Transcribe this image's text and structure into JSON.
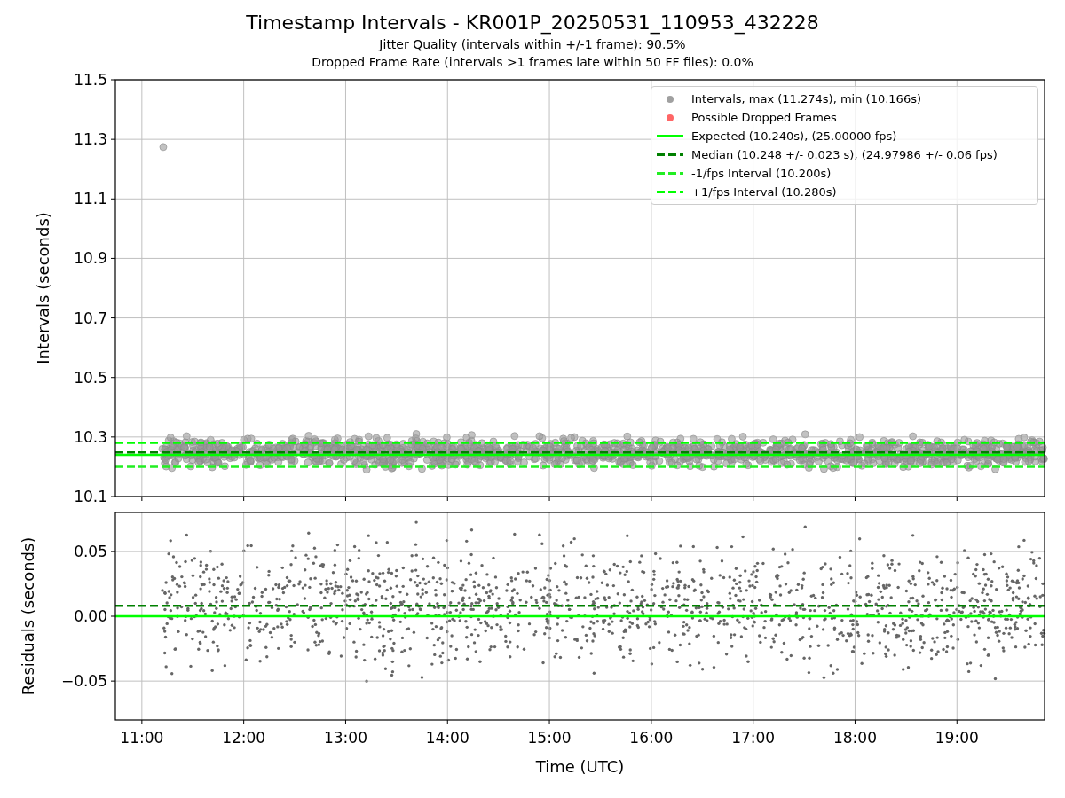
{
  "title": "Timestamp Intervals - KR001P_20250531_110953_432228",
  "subtitles": [
    "Jitter Quality (intervals within +/-1 frame): 90.5%",
    "Dropped Frame Rate (intervals >1 frames late within 50 FF files): 0.0%"
  ],
  "intervals_plot": {
    "chart_data": {
      "type": "line",
      "ylabel": "Intervals (seconds)",
      "grid": true,
      "x": [
        10.74,
        19.86
      ],
      "xlim": [
        10.74,
        19.86
      ],
      "ylim": [
        10.1,
        11.5
      ],
      "yticks": [
        {
          "value": 10.1,
          "label": "10.1"
        },
        {
          "value": 10.3,
          "label": "10.3"
        },
        {
          "value": 10.5,
          "label": "10.5"
        },
        {
          "value": 10.7,
          "label": "10.7"
        },
        {
          "value": 10.9,
          "label": "10.9"
        },
        {
          "value": 11.1,
          "label": "11.1"
        },
        {
          "value": 11.3,
          "label": "11.3"
        },
        {
          "value": 11.5,
          "label": "11.5"
        }
      ],
      "series": [
        {
          "color": "#22ee22",
          "line_style": "dashed",
          "values": [
            10.2,
            10.2
          ]
        },
        {
          "color": "#00ff00",
          "line_style": "dashed",
          "values": [
            10.28,
            10.28
          ]
        },
        {
          "color": "#00ff00",
          "line_style": "solid",
          "values": [
            10.24,
            10.24
          ]
        },
        {
          "color": "#008000",
          "line_style": "dashed",
          "values": [
            10.248,
            10.248
          ]
        }
      ]
    },
    "legend": [
      {
        "kind": "marker",
        "color": "#a0a0a0",
        "label": "Intervals, max (11.274s), min (10.166s)"
      },
      {
        "kind": "marker",
        "color": "#ff6666",
        "label": "Possible Dropped Frames"
      },
      {
        "kind": "line",
        "color": "#00ff00",
        "label": "Expected (10.240s), (25.00000 fps)"
      },
      {
        "kind": "dashed",
        "color": "#008000",
        "label": "Median (10.248 +/- 0.023 s), (24.97986 +/- 0.06 fps)"
      },
      {
        "kind": "dashed",
        "color": "#22ee22",
        "label": "-1/fps Interval (10.200s)"
      },
      {
        "kind": "dashed",
        "color": "#00ff00",
        "label": "+1/fps Interval (10.280s)"
      }
    ]
  },
  "residuals_plot": {
    "chart_data": {
      "type": "line",
      "xlabel": "Time (UTC)",
      "ylabel": "Residuals (seconds)",
      "grid": true,
      "x": [
        10.74,
        19.86
      ],
      "xlim": [
        10.74,
        19.86
      ],
      "ylim": [
        -0.08,
        0.08
      ],
      "xticks": [
        {
          "value": 11,
          "label": "11:00"
        },
        {
          "value": 12,
          "label": "12:00"
        },
        {
          "value": 13,
          "label": "13:00"
        },
        {
          "value": 14,
          "label": "14:00"
        },
        {
          "value": 15,
          "label": "15:00"
        },
        {
          "value": 16,
          "label": "16:00"
        },
        {
          "value": 17,
          "label": "17:00"
        },
        {
          "value": 18,
          "label": "18:00"
        },
        {
          "value": 19,
          "label": "19:00"
        }
      ],
      "yticks": [
        {
          "value": -0.05,
          "label": "−0.05"
        },
        {
          "value": 0,
          "label": "0.00"
        },
        {
          "value": 0.05,
          "label": "0.05"
        }
      ],
      "series": [
        {
          "color": "#00ff00",
          "line_style": "solid",
          "values": [
            0,
            0
          ]
        },
        {
          "color": "#008000",
          "line_style": "dashed",
          "values": [
            0.008,
            0.008
          ]
        }
      ]
    }
  }
}
